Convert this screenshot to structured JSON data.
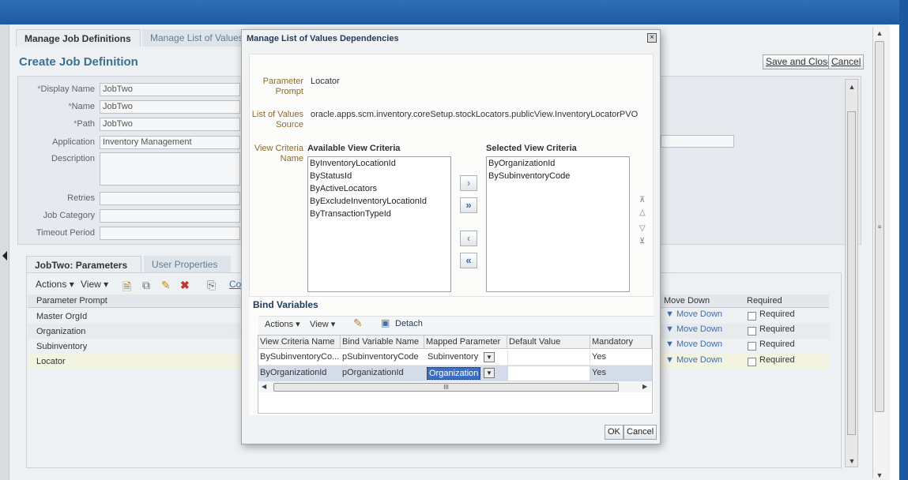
{
  "page": {
    "tabs": [
      "Manage Job Definitions",
      "Manage List of Values"
    ],
    "title": "Create Job Definition",
    "save_close": "Save and Close",
    "cancel": "Cancel"
  },
  "form": {
    "display_name_label": "Display Name",
    "display_name_value": "JobTwo",
    "name_label": "Name",
    "name_value": "JobTwo",
    "path_label": "Path",
    "path_value": "JobTwo",
    "application_label": "Application",
    "application_value": "Inventory Management",
    "description_label": "Description",
    "retries_label": "Retries",
    "job_category_label": "Job Category",
    "timeout_label": "Timeout Period",
    "required_marker": "*"
  },
  "params": {
    "tabs": [
      "JobTwo: Parameters",
      "User Properties"
    ],
    "actions": "Actions",
    "view": "View",
    "co_fragment": "Co",
    "col_prompt": "Parameter Prompt",
    "col_move_down": "Move Down",
    "col_required": "Required",
    "rows": [
      {
        "prompt": "Master OrgId",
        "move": "Move Down",
        "req": "Required"
      },
      {
        "prompt": "Organization",
        "move": "Move Down",
        "req": "Required"
      },
      {
        "prompt": "Subinventory",
        "move": "Move Down",
        "req": "Required"
      },
      {
        "prompt": "Locator",
        "move": "Move Down",
        "req": "Required"
      }
    ]
  },
  "dialog": {
    "title": "Manage List of Values Dependencies",
    "param_prompt_label": "Parameter Prompt",
    "param_prompt_value": "Locator",
    "lov_source_label": "List of Values Source",
    "lov_source_value": "oracle.apps.scm.inventory.coreSetup.stockLocators.publicView.InventoryLocatorPVO",
    "view_criteria_label": "View Criteria Name",
    "available_header": "Available View Criteria",
    "selected_header": "Selected View Criteria",
    "available": [
      "ByInventoryLocationId",
      "ByStatusId",
      "ByActiveLocators",
      "ByExcludeInventoryLocationId",
      "ByTransactionTypeId"
    ],
    "selected": [
      "ByOrganizationId",
      "BySubinventoryCode"
    ],
    "bind_title": "Bind Variables",
    "bind_actions": "Actions",
    "bind_view": "View",
    "detach": "Detach",
    "bind_columns": [
      "View Criteria Name",
      "Bind Variable Name",
      "Mapped Parameter",
      "Default Value",
      "Mandatory"
    ],
    "bind_rows": [
      {
        "criteria": "BySubinventoryCo...",
        "bind": "pSubinventoryCode",
        "mapped": "Subinventory",
        "default": "",
        "mandatory": "Yes"
      },
      {
        "criteria": "ByOrganizationId",
        "bind": "pOrganizationId",
        "mapped": "Organization",
        "default": "",
        "mandatory": "Yes"
      }
    ],
    "scroll_grip": "III",
    "ok": "OK",
    "cancel": "Cancel"
  },
  "icons": {
    "move_right": "›",
    "move_all_right": "»",
    "move_left": "‹",
    "move_all_left": "«"
  }
}
